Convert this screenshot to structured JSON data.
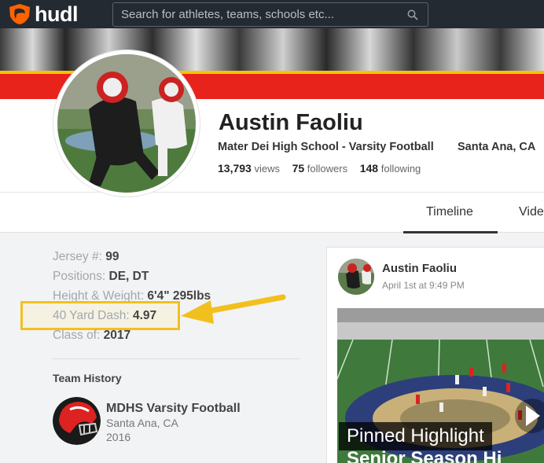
{
  "brand": {
    "name": "hudl"
  },
  "search": {
    "placeholder": "Search for athletes, teams, schools etc..."
  },
  "profile": {
    "name": "Austin Faoliu",
    "school": "Mater Dei High School - Varsity Football",
    "location": "Santa Ana, CA",
    "views_count": "13,793",
    "views_label": "views",
    "followers_count": "75",
    "followers_label": "followers",
    "following_count": "148",
    "following_label": "following"
  },
  "tabs": [
    {
      "label": "Timeline"
    },
    {
      "label": "Vide"
    }
  ],
  "details": {
    "jersey_label": "Jersey #:",
    "jersey_value": "99",
    "positions_label": "Positions:",
    "positions_value": "DE, DT",
    "height_weight_label": "Height & Weight:",
    "height_weight_value": "6'4\" 295lbs",
    "dash_label": "40 Yard Dash:",
    "dash_value": "4.97",
    "class_label": "Class of:",
    "class_value": "2017"
  },
  "team_history": {
    "heading": "Team History",
    "teams": [
      {
        "name": "MDHS Varsity Football",
        "location": "Santa Ana, CA",
        "year": "2016"
      }
    ]
  },
  "feed": {
    "author": "Austin Faoliu",
    "date": "April 1st at 9:49 PM",
    "overlay_label": "Pinned Highlight",
    "overlay_title": "Senior Season Hi"
  },
  "colors": {
    "topbar": "#232a31",
    "brand_orange": "#ff6300",
    "banner_red": "#e8231b",
    "banner_yellow": "#f5c400",
    "highlight": "#f2c01e"
  },
  "icons": {
    "logo": "hudl-logo-icon",
    "search": "search-icon",
    "play": "play-icon",
    "arrow": "annotation-arrow-icon"
  }
}
